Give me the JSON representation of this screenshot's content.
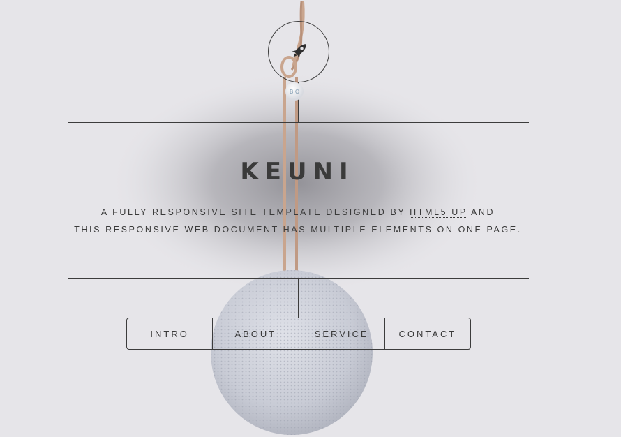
{
  "site": {
    "title": "KEUNI",
    "subtitle_line1_pre": "A FULLY RESPONSIVE SITE TEMPLATE DESIGNED BY",
    "subtitle_link": "HTML5 UP",
    "subtitle_line1_post": "AND",
    "subtitle_line2": "THIS RESPONSIVE WEB DOCUMENT HAS MULTIPLE ELEMENTS ON ONE PAGE.",
    "logo_icon": "rocket-icon",
    "speaker_tag": "B O"
  },
  "nav": {
    "items": [
      {
        "label": "INTRO"
      },
      {
        "label": "ABOUT"
      },
      {
        "label": "SERVICE"
      },
      {
        "label": "CONTACT"
      }
    ]
  },
  "colors": {
    "background": "#e6e5e9",
    "lines": "#3c3c3c",
    "text": "#3a3a3a",
    "speaker": "#c9ccd6",
    "cord": "#c9a58e"
  }
}
